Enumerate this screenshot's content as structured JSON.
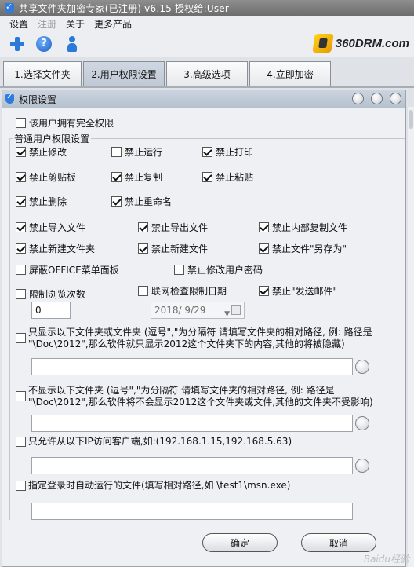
{
  "window": {
    "title": "共享文件夹加密专家(已注册) v6.15  授权给:User"
  },
  "menu": [
    "设置",
    "注册",
    "关于",
    "更多产品"
  ],
  "logo": {
    "text": "360DRM.com"
  },
  "tabs": [
    {
      "label": "1.选择文件夹",
      "active": false
    },
    {
      "label": "2.用户权限设置",
      "active": true
    },
    {
      "label": "3.高级选项",
      "active": false
    },
    {
      "label": "4.立即加密",
      "active": false
    }
  ],
  "panel": {
    "title": "权限设置"
  },
  "full_rights": {
    "label": "该用户拥有完全权限",
    "checked": false
  },
  "group": {
    "title": "普通用户权限设置"
  },
  "perm": {
    "no_modify": {
      "label": "禁止修改",
      "checked": true
    },
    "no_run": {
      "label": "禁止运行",
      "checked": false
    },
    "no_print": {
      "label": "禁止打印",
      "checked": true
    },
    "no_clipboard": {
      "label": "禁止剪贴板",
      "checked": true
    },
    "no_copy": {
      "label": "禁止复制",
      "checked": true
    },
    "no_paste": {
      "label": "禁止粘贴",
      "checked": true
    },
    "no_delete": {
      "label": "禁止删除",
      "checked": true
    },
    "no_rename": {
      "label": "禁止重命名",
      "checked": true
    },
    "no_import": {
      "label": "禁止导入文件",
      "checked": true
    },
    "no_export": {
      "label": "禁止导出文件",
      "checked": true
    },
    "no_internal_copy": {
      "label": "禁止内部复制文件",
      "checked": true
    },
    "no_new_folder": {
      "label": "禁止新建文件夹",
      "checked": true
    },
    "no_new_file": {
      "label": "禁止新建文件",
      "checked": true
    },
    "no_save_as": {
      "label": "禁止文件\"另存为\"",
      "checked": true
    },
    "hide_office_ribbon": {
      "label": "屏蔽OFFICE菜单面板",
      "checked": false
    },
    "no_change_pwd": {
      "label": "禁止修改用户密码",
      "checked": false
    },
    "limit_views": {
      "label": "限制浏览次数",
      "checked": false
    },
    "online_date_check": {
      "label": "联网检查限制日期",
      "checked": false
    },
    "no_send_mail": {
      "label": "禁止\"发送邮件\"",
      "checked": true
    }
  },
  "limit_views_value": "0",
  "date_value": "2018/  9/29",
  "show_only": {
    "checked": false,
    "text": "只显示以下文件夹或文件夹 (逗号\",\"为分隔符 请填写文件夹的相对路径, 例: 路径是 \"\\Doc\\2012\",那么软件就只显示2012这个文件夹下的内容,其他的将被隐藏)",
    "value": ""
  },
  "hide_only": {
    "checked": false,
    "text": "不显示以下文件夹 (逗号\",\"为分隔符 请填写文件夹的相对路径, 例: 路径是 \"\\Doc\\2012\",那么软件将不会显示2012这个文件夹或文件,其他的文件夹不受影响)",
    "value": ""
  },
  "ip_allow": {
    "checked": false,
    "text": "只允许从以下IP访问客户端,如:(192.168.1.15,192.168.5.63)",
    "value": ""
  },
  "autorun": {
    "checked": false,
    "text": "指定登录时自动运行的文件(填写相对路径,如 \\test1\\msn.exe)",
    "value": ""
  },
  "buttons": {
    "ok": "确定",
    "cancel": "取消"
  },
  "watermark": "Baidu经验"
}
